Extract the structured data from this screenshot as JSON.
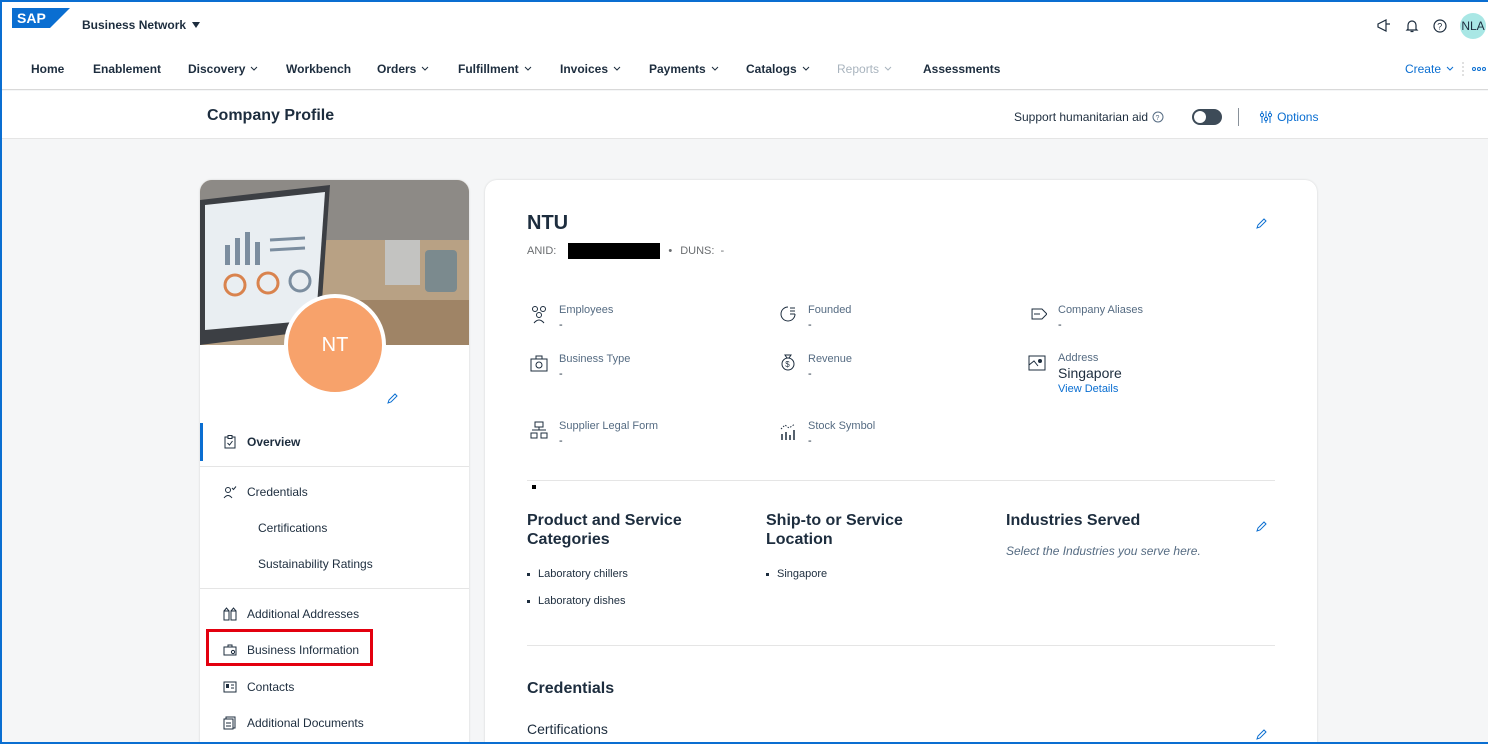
{
  "shell": {
    "logo": "SAP",
    "product": "Business Network",
    "user_initials": "NLA",
    "icons": [
      "megaphone-icon",
      "bell-icon",
      "help-icon"
    ]
  },
  "nav": {
    "items": [
      {
        "label": "Home",
        "dropdown": false,
        "disabled": false
      },
      {
        "label": "Enablement",
        "dropdown": false,
        "disabled": false
      },
      {
        "label": "Discovery",
        "dropdown": true,
        "disabled": false
      },
      {
        "label": "Workbench",
        "dropdown": false,
        "disabled": false
      },
      {
        "label": "Orders",
        "dropdown": true,
        "disabled": false
      },
      {
        "label": "Fulfillment",
        "dropdown": true,
        "disabled": false
      },
      {
        "label": "Invoices",
        "dropdown": true,
        "disabled": false
      },
      {
        "label": "Payments",
        "dropdown": true,
        "disabled": false
      },
      {
        "label": "Catalogs",
        "dropdown": true,
        "disabled": false
      },
      {
        "label": "Reports",
        "dropdown": true,
        "disabled": true
      },
      {
        "label": "Assessments",
        "dropdown": false,
        "disabled": false
      }
    ],
    "create_label": "Create"
  },
  "header": {
    "title": "Company Profile",
    "humanitarian_label": "Support humanitarian aid",
    "options_label": "Options"
  },
  "sidebar": {
    "avatar_initials": "NT",
    "overview": "Overview",
    "credentials": "Credentials",
    "certifications": "Certifications",
    "sustainability": "Sustainability Ratings",
    "additional_addresses": "Additional Addresses",
    "business_information": "Business Information",
    "contacts": "Contacts",
    "additional_documents": "Additional Documents"
  },
  "company": {
    "name": "NTU",
    "anid_label": "ANID:",
    "duns_label": "DUNS:",
    "duns_value": "-",
    "fields": {
      "employees": {
        "label": "Employees",
        "value": "-"
      },
      "founded": {
        "label": "Founded",
        "value": "-"
      },
      "aliases": {
        "label": "Company Aliases",
        "value": "-"
      },
      "business_type": {
        "label": "Business Type",
        "value": "-"
      },
      "revenue": {
        "label": "Revenue",
        "value": "-"
      },
      "address": {
        "label": "Address",
        "value": "Singapore",
        "link": "View Details"
      },
      "legal_form": {
        "label": "Supplier Legal Form",
        "value": "-"
      },
      "stock_symbol": {
        "label": "Stock Symbol",
        "value": "-"
      }
    }
  },
  "sections": {
    "categories_title": "Product and Service Categories",
    "categories": [
      "Laboratory chillers",
      "Laboratory dishes"
    ],
    "location_title": "Ship-to or Service Location",
    "locations": [
      "Singapore"
    ],
    "industries_title": "Industries Served",
    "industries_hint": "Select the Industries you serve here.",
    "credentials_title": "Credentials",
    "certifications_title": "Certifications"
  },
  "colors": {
    "accent": "#0a6ed1",
    "avatar": "#f7a26b",
    "highlight": "#e3000f"
  }
}
